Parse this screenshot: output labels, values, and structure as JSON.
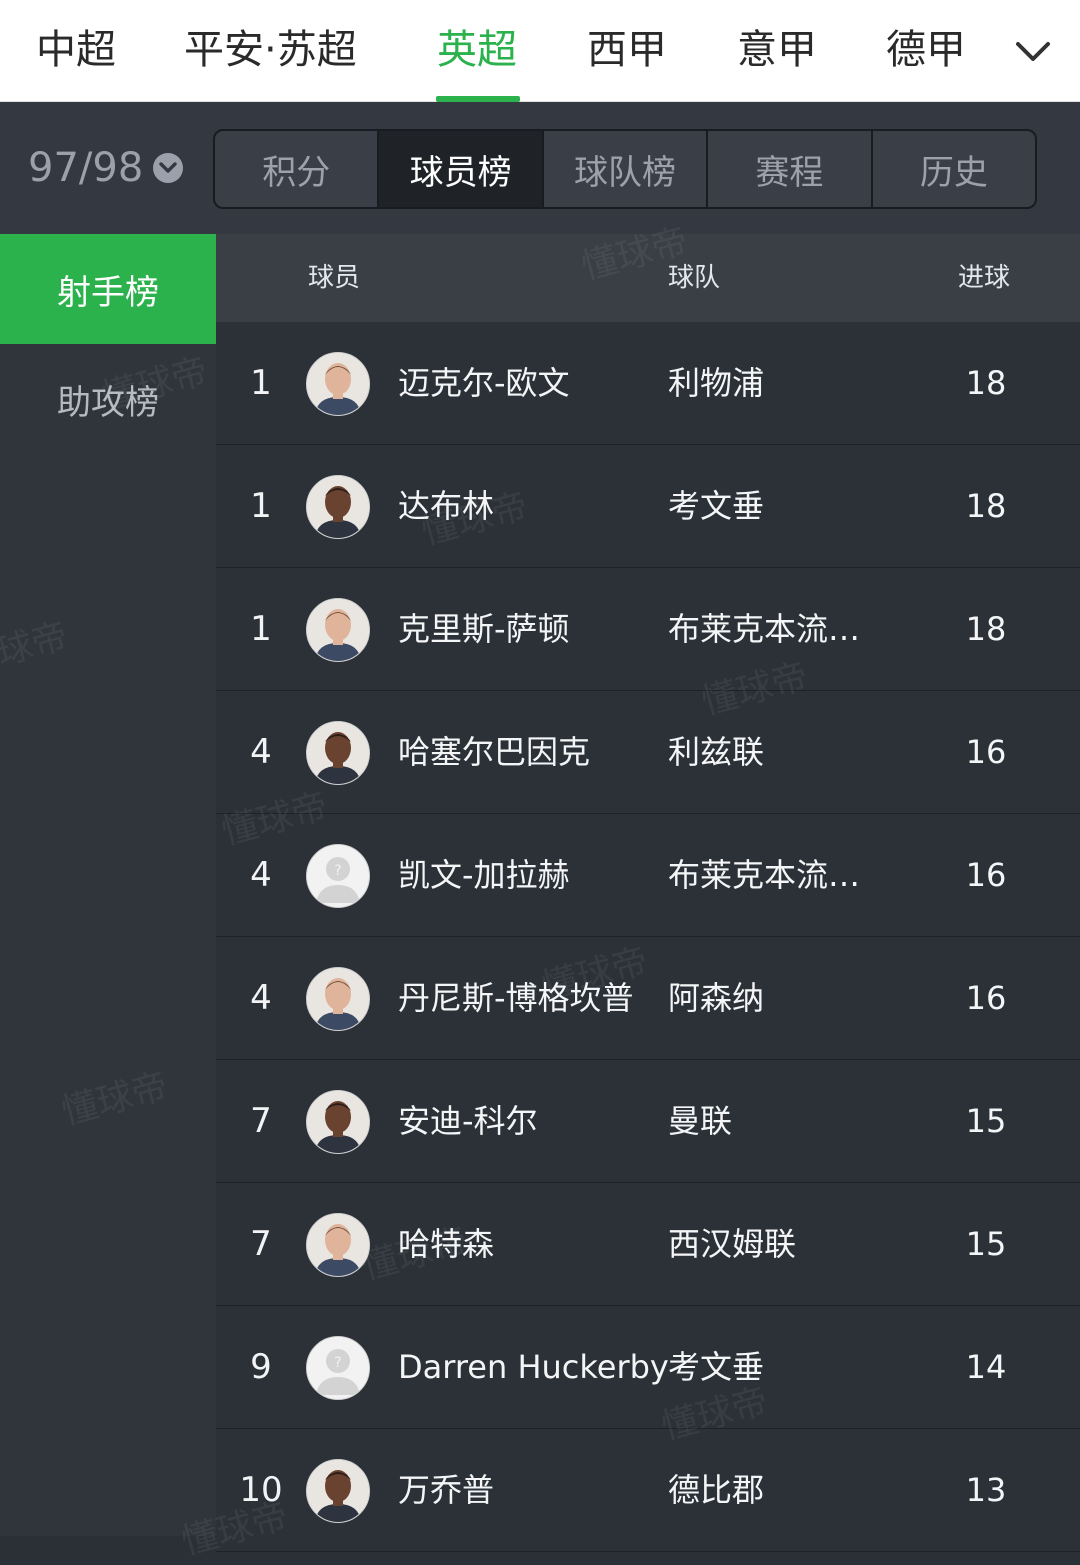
{
  "league_tabs": [
    {
      "label": "中超",
      "active": false
    },
    {
      "label": "平安·苏超",
      "active": false
    },
    {
      "label": "英超",
      "active": true
    },
    {
      "label": "西甲",
      "active": false
    },
    {
      "label": "意甲",
      "active": false
    },
    {
      "label": "德甲",
      "active": false
    }
  ],
  "season": {
    "label": "97/98"
  },
  "segments": [
    {
      "label": "积分",
      "active": false
    },
    {
      "label": "球员榜",
      "active": true
    },
    {
      "label": "球队榜",
      "active": false
    },
    {
      "label": "赛程",
      "active": false
    },
    {
      "label": "历史",
      "active": false
    }
  ],
  "side_nav": [
    {
      "label": "射手榜",
      "active": true
    },
    {
      "label": "助攻榜",
      "active": false
    }
  ],
  "table": {
    "headers": {
      "player": "球员",
      "team": "球队",
      "goals": "进球"
    },
    "rows": [
      {
        "rank": "1",
        "name": "迈克尔-欧文",
        "team": "利物浦",
        "goals": "18",
        "avatar": "photo-light"
      },
      {
        "rank": "1",
        "name": "达布林",
        "team": "考文垂",
        "goals": "18",
        "avatar": "photo-dark"
      },
      {
        "rank": "1",
        "name": "克里斯-萨顿",
        "team": "布莱克本流…",
        "goals": "18",
        "avatar": "photo-light"
      },
      {
        "rank": "4",
        "name": "哈塞尔巴因克",
        "team": "利兹联",
        "goals": "16",
        "avatar": "photo-dark"
      },
      {
        "rank": "4",
        "name": "凯文-加拉赫",
        "team": "布莱克本流…",
        "goals": "16",
        "avatar": "placeholder"
      },
      {
        "rank": "4",
        "name": "丹尼斯-博格坎普",
        "team": "阿森纳",
        "goals": "16",
        "avatar": "photo-light"
      },
      {
        "rank": "7",
        "name": "安迪-科尔",
        "team": "曼联",
        "goals": "15",
        "avatar": "photo-dark"
      },
      {
        "rank": "7",
        "name": "哈特森",
        "team": "西汉姆联",
        "goals": "15",
        "avatar": "photo-light"
      },
      {
        "rank": "9",
        "name": "Darren Huckerby",
        "team": "考文垂",
        "goals": "14",
        "avatar": "placeholder"
      },
      {
        "rank": "10",
        "name": "万乔普",
        "team": "德比郡",
        "goals": "13",
        "avatar": "photo-dark"
      }
    ]
  },
  "watermark": "懂球帝",
  "colors": {
    "accent": "#2bb24c",
    "background": "#2b3037"
  }
}
